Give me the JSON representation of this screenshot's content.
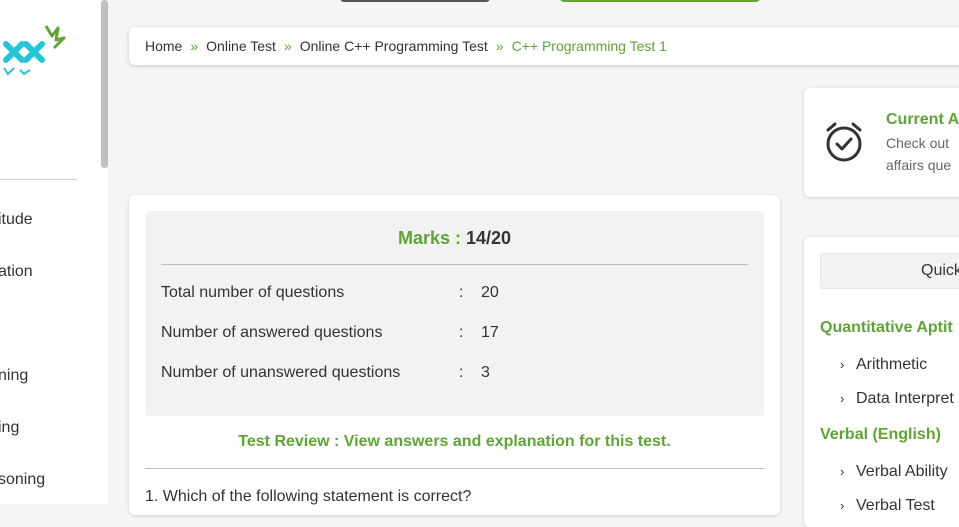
{
  "sidebar": {
    "items": [
      {
        "label": "itude"
      },
      {
        "label": "ation"
      },
      {
        "label": "ning"
      },
      {
        "label": "ing"
      },
      {
        "label": "soning"
      }
    ]
  },
  "breadcrumb": {
    "items": [
      "Home",
      "Online Test",
      "Online C++ Programming Test"
    ],
    "separator": "»",
    "current": "C++ Programming Test 1"
  },
  "result": {
    "marks_label": "Marks :",
    "marks_value": "14/20",
    "stats": [
      {
        "label": "Total number of questions",
        "separator": ":",
        "value": "20"
      },
      {
        "label": "Number of answered questions",
        "separator": ":",
        "value": "17"
      },
      {
        "label": "Number of unanswered questions",
        "separator": ":",
        "value": "3"
      }
    ],
    "review_link": "Test Review : View answers and explanation for this test.",
    "first_question": "1. Which of the following statement is correct?"
  },
  "current_affairs": {
    "title": "Current A",
    "description": "Check out affairs que",
    "icon": "alarm-clock-check-icon"
  },
  "quick_links": {
    "header": "Quick",
    "sections": [
      {
        "title": "Quantitative Aptit",
        "items": [
          "Arithmetic",
          "Data Interpret"
        ]
      },
      {
        "title": "Verbal (English)",
        "items": [
          "Verbal Ability",
          "Verbal Test"
        ]
      }
    ]
  },
  "colors": {
    "accent": "#5ea534",
    "text": "#333333",
    "background": "#f5f5f5",
    "panel": "#f2f2f2"
  }
}
